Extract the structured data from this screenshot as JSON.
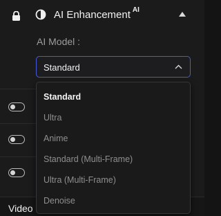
{
  "header": {
    "title": "AI Enhancement",
    "title_badge": "AI",
    "icons": [
      "lock-icon",
      "contrast-icon",
      "collapse-triangle-icon"
    ]
  },
  "model": {
    "label": "AI Model :",
    "selected": "Standard",
    "options": [
      "Standard",
      "Ultra",
      "Anime",
      "Standard (Multi-Frame)",
      "Ultra (Multi-Frame)",
      "Denoise"
    ]
  },
  "toggles": [
    {
      "state": "off"
    },
    {
      "state": "off"
    },
    {
      "state": "off"
    }
  ],
  "bottom_section": {
    "title": "Video Settings"
  },
  "colors": {
    "accent": "#4a5bd6",
    "background": "#1b1b1c",
    "text": "#f2f2f2",
    "muted_text": "#9d9d9d"
  }
}
